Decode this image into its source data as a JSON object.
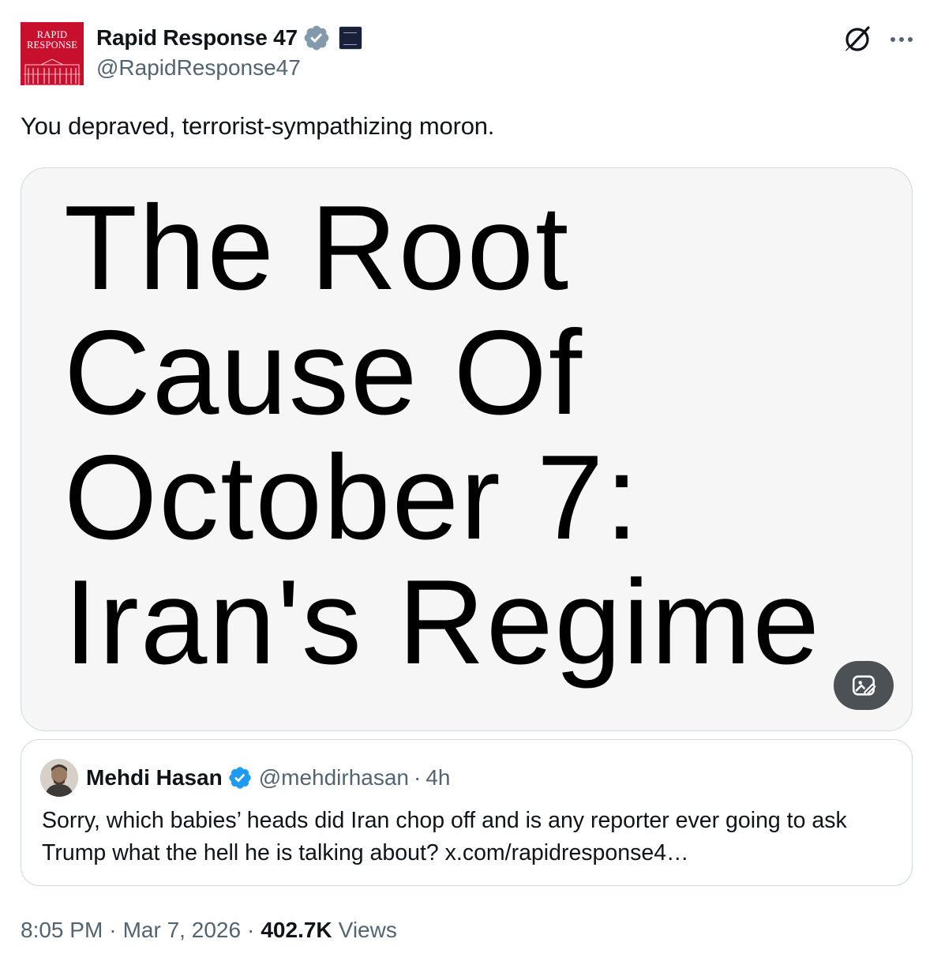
{
  "tweet": {
    "author": {
      "display_name": "Rapid Response 47",
      "handle": "@RapidResponse47",
      "avatar_text_line1": "RAPID",
      "avatar_text_line2": "RESPONSE",
      "verified_color": "#829aab",
      "brand_color": "#c8102e"
    },
    "text": "You depraved, terrorist-sympathizing moron.",
    "media": {
      "headline_lines": [
        "The Root",
        "Cause Of",
        "October 7:",
        "Iran's Regime"
      ],
      "background": "#f6f6f6"
    },
    "quoted": {
      "display_name": "Mehdi Hasan",
      "handle": "@mehdirhasan",
      "separator": "·",
      "time": "4h",
      "text": "Sorry, which babies’ heads did Iran chop off and is any reporter ever going to ask Trump what the hell he is talking about? x.com/rapidresponse4…",
      "verified_color": "#1d9bf0"
    },
    "meta": {
      "time": "8:05 PM",
      "date": "Mar 7, 2026",
      "separator": "·",
      "views_count": "402.7K",
      "views_label": "Views"
    },
    "icons": {
      "verified": "verified-badge-icon",
      "affiliation": "white-house-affiliation-icon",
      "grok": "grok-icon",
      "more": "more-options-icon",
      "alt": "image-alt-icon"
    }
  }
}
